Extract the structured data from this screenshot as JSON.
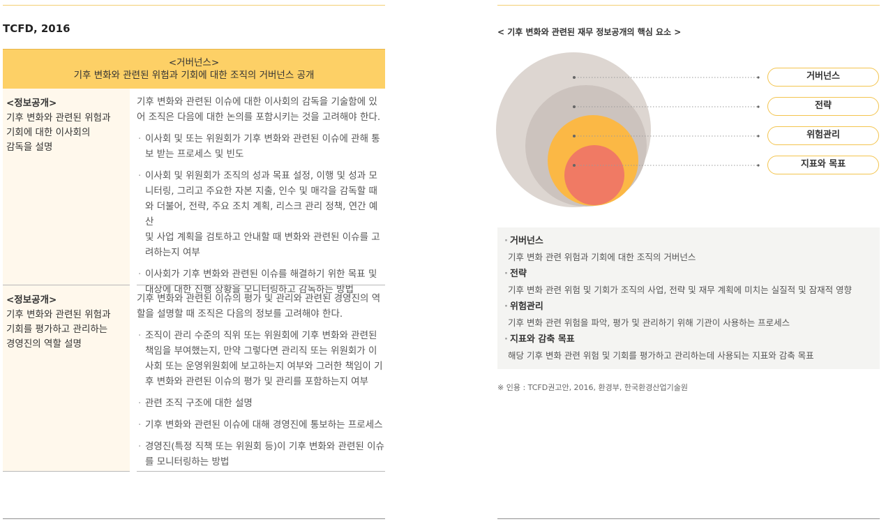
{
  "left": {
    "heading": "TCFD, 2016",
    "table_header": {
      "line1": "<거버넌스>",
      "line2": "기후 변화와 관련된 위험과 기회에 대한 조직의 거버넌스 공개"
    },
    "rows": [
      {
        "left_title": "<정보공개>",
        "left_body": [
          "기후 변화와 관련된 위험과",
          "기회에 대한 이사회의",
          "감독을 설명"
        ],
        "intro": [
          "기후 변화와 관련된 이슈에 대한 이사회의 감독을 기술함에 있",
          "어 조직은 다음에 대한 논의를 포함시키는 것을 고려해야 한다."
        ],
        "bullets": [
          [
            "이사회 및 또는 위원회가 기후 변화와 관련된 이슈에 관해 통",
            "보 받는 프로세스 및 빈도"
          ],
          [
            "이사회 및 위원회가 조직의 성과 목표 설정, 이행 및 성과 모",
            "니터링, 그리고 주요한 자본 지출, 인수 및 매각을 감독할 때",
            "와 더불어, 전략, 주요 조치 계획, 리스크 관리 정책, 연간 예산",
            "및 사업 계획을 검토하고 안내할 때 변화와 관련된 이슈를 고",
            "려하는지 여부"
          ],
          [
            "이사회가 기후 변화와 관련된 이슈를 해결하기 위한 목표 및",
            "대상에 대한 진행 상황을 모니터링하고 감독하는 방법"
          ]
        ]
      },
      {
        "left_title": "<정보공개>",
        "left_body": [
          "기후 변화와 관련된 위험과",
          "기회를 평가하고 관리하는",
          "경영진의 역할 설명"
        ],
        "intro": [
          "기후 변화와 관련된 이슈의 평가 및 관리와 관련된 경영진의 역",
          "할을 설명할 때 조직은 다음의 정보를 고려해야 한다."
        ],
        "bullets": [
          [
            "조직이 관리 수준의 직위 또는 위원회에 기후 변화와 관련된",
            "책임을 부여했는지, 만약 그렇다면 관리직 또는 위원회가 이",
            "사회 또는 운영위원회에 보고하는지 여부와 그러한 책임이 기",
            "후 변화와 관련된 이슈의 평가 및 관리를 포함하는지 여부"
          ],
          [
            "관련 조직 구조에 대한 설명"
          ],
          [
            "기후 변화와 관련된 이슈에 대해 경영진에 통보하는 프로세스"
          ],
          [
            "경영진(특정 직책 또는 위원회 등)이 기후 변화와 관련된 이슈",
            "를 모니터링하는 방법"
          ]
        ]
      }
    ]
  },
  "right": {
    "heading": "< 기후 변화와 관련된 재무 정보공개의 핵심 요소 >",
    "diagram": {
      "labels": [
        "거버넌스",
        "전략",
        "위험관리",
        "지표와 목표"
      ],
      "colors": {
        "governance": "#ddd6d1",
        "strategy": "#ccc3be",
        "risk": "#fbb845",
        "metrics": "#f07a64",
        "pill_border": "#f3c44e"
      }
    },
    "descriptions": [
      {
        "title": "거버넌스",
        "body": "기후 변화 관련 위험과 기회에 대한 조직의 거버넌스"
      },
      {
        "title": "전략",
        "body": "기후 변화 관련 위험 및 기회가 조직의 사업, 전략 및 재무 계획에 미치는 실질적 및 잠재적 영향"
      },
      {
        "title": "위험관리",
        "body": "기후 변화 관련 위험을 파악, 평가 및 관리하기 위해 기관이 사용하는 프로세스"
      },
      {
        "title": "지표와 감축 목표",
        "body": "해당 기후 변화 관련 위험 및 기회를 평가하고 관리하는데 사용되는 지표와 감축 목표"
      }
    ],
    "source": "※ 인용 : TCFD권고안, 2016, 환경부, 한국환경산업기술원"
  }
}
